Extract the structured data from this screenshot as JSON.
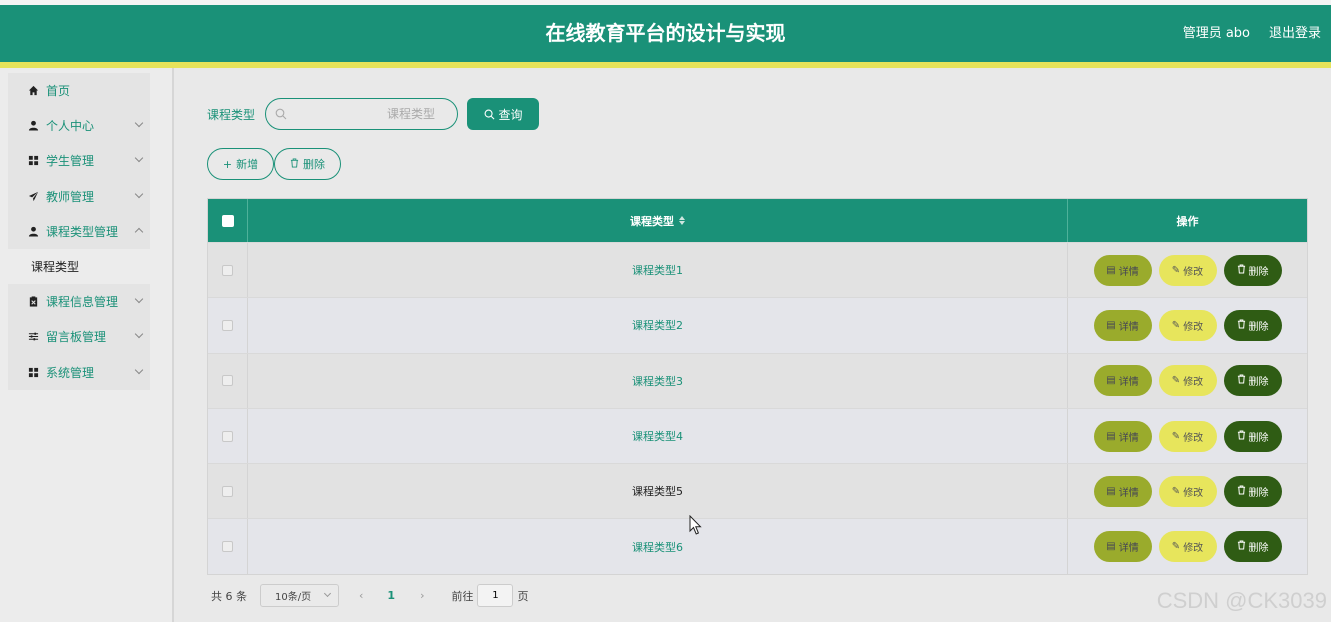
{
  "header": {
    "title": "在线教育平台的设计与实现",
    "user": "管理员 abo",
    "logout": "退出登录",
    "color": "#1a9178",
    "accent_bar": "#e6e35a"
  },
  "sidebar": {
    "items": [
      {
        "label": "首页",
        "icon": "home-icon",
        "expandable": false
      },
      {
        "label": "个人中心",
        "icon": "user-icon",
        "expandable": true
      },
      {
        "label": "学生管理",
        "icon": "grid-icon",
        "expandable": true
      },
      {
        "label": "教师管理",
        "icon": "send-icon",
        "expandable": true
      },
      {
        "label": "课程类型管理",
        "icon": "user-icon",
        "expandable": true
      },
      {
        "label": "课程类型",
        "sub": true
      },
      {
        "label": "课程信息管理",
        "icon": "clipboard-icon",
        "expandable": true
      },
      {
        "label": "留言板管理",
        "icon": "sliders-icon",
        "expandable": true
      },
      {
        "label": "系统管理",
        "icon": "grid-icon",
        "expandable": true
      }
    ]
  },
  "search": {
    "label": "课程类型",
    "placeholder": "课程类型",
    "value": "",
    "button": "查询"
  },
  "toolbar": {
    "add": "新增",
    "delete": "删除"
  },
  "table": {
    "columns": [
      "课程类型",
      "操作"
    ],
    "rows": [
      {
        "name": "课程类型1"
      },
      {
        "name": "课程类型2"
      },
      {
        "name": "课程类型3"
      },
      {
        "name": "课程类型4"
      },
      {
        "name": "课程类型5"
      },
      {
        "name": "课程类型6"
      }
    ],
    "row_actions": {
      "detail": "详情",
      "edit": "修改",
      "delete": "删除"
    },
    "action_colors": {
      "detail": "#9aab2c",
      "edit": "#e7e55c",
      "delete": "#2f5c14"
    }
  },
  "pagination": {
    "total": "共 6 条",
    "page_size": "10条/页",
    "current_page": "1",
    "goto_label": "前往",
    "goto_value": "1",
    "page_suffix": "页"
  },
  "watermark": "CSDN @CK3039"
}
